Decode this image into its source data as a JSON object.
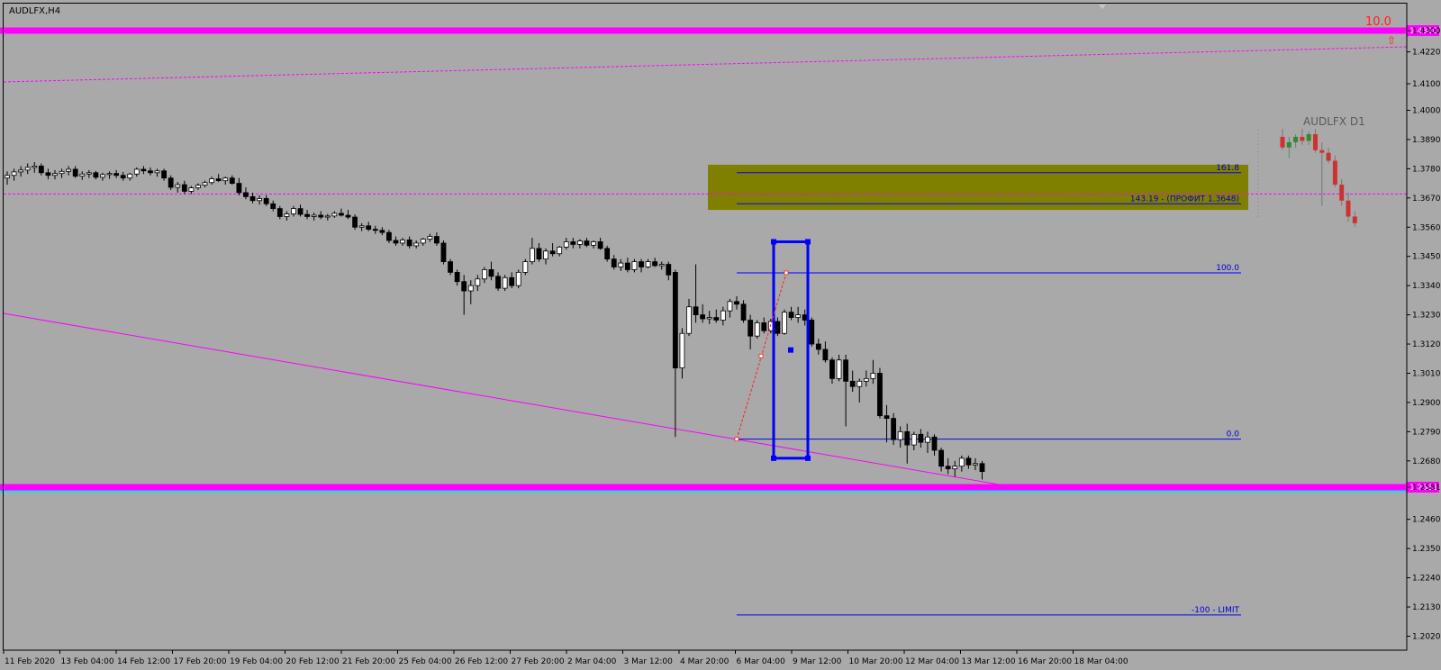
{
  "symbol_title": "AUDLFX,H4",
  "mini_chart_title": "AUDLFX D1",
  "corner_value": "10.0",
  "corner_arrow": "⇧",
  "colors": {
    "background": "#a9a9a9",
    "magenta": "#ff00ff",
    "cyan": "#00e5ee",
    "fib_blue": "#0000ff",
    "zone": "#808000",
    "bull": "#ffffff",
    "bear": "#000000",
    "red": "#ff2020"
  },
  "chart_data": {
    "type": "candlestick",
    "y_range": [
      1.2,
      1.44
    ],
    "price_ticks": [
      "1.4300",
      "1.4220",
      "1.4100",
      "1.4000",
      "1.3890",
      "1.3780",
      "1.3670",
      "1.3560",
      "1.3450",
      "1.3340",
      "1.3230",
      "1.3120",
      "1.3010",
      "1.2900",
      "1.2790",
      "1.2680",
      "1.2581",
      "1.2460",
      "1.2350",
      "1.2240",
      "1.2130",
      "1.2020"
    ],
    "time_labels": [
      "11 Feb 2020",
      "13 Feb 04:00",
      "14 Feb 12:00",
      "17 Feb 20:00",
      "19 Feb 04:00",
      "20 Feb 12:00",
      "21 Feb 20:00",
      "25 Feb 04:00",
      "26 Feb 12:00",
      "27 Feb 20:00",
      "2 Mar 04:00",
      "3 Mar 12:00",
      "4 Mar 20:00",
      "6 Mar 04:00",
      "9 Mar 12:00",
      "10 Mar 20:00",
      "12 Mar 04:00",
      "13 Mar 12:00",
      "16 Mar 20:00",
      "18 Mar 04:00"
    ],
    "horizontal_lines": [
      {
        "name": "upper-level",
        "price": 1.43,
        "label": "1.4300",
        "color": "#ff00ff"
      },
      {
        "name": "lower-level",
        "price": 1.2581,
        "label": "1.2581",
        "color": "#ff00ff"
      }
    ],
    "fib_levels": [
      {
        "level": "161.8",
        "price": 1.3765
      },
      {
        "level": "143.19 - (ПРОФИТ 1.3648)",
        "price": 1.3648
      },
      {
        "level": "100.0",
        "price": 1.3388
      },
      {
        "level": "0.0",
        "price": 1.2762
      },
      {
        "level": "-100 - LIMIT",
        "price": 1.21
      }
    ],
    "target_zone": [
      1.3625,
      1.3795
    ],
    "candles": [
      [
        1.3745,
        1.377,
        1.372,
        1.3755
      ],
      [
        1.3755,
        1.378,
        1.3735,
        1.3768
      ],
      [
        1.3768,
        1.379,
        1.375,
        1.3775
      ],
      [
        1.3775,
        1.38,
        1.376,
        1.3785
      ],
      [
        1.3785,
        1.3805,
        1.3765,
        1.379
      ],
      [
        1.379,
        1.38,
        1.3755,
        1.3765
      ],
      [
        1.3765,
        1.378,
        1.374,
        1.3755
      ],
      [
        1.3755,
        1.3775,
        1.374,
        1.3762
      ],
      [
        1.3762,
        1.378,
        1.3745,
        1.377
      ],
      [
        1.377,
        1.379,
        1.3755,
        1.3778
      ],
      [
        1.3778,
        1.379,
        1.3745,
        1.3752
      ],
      [
        1.3752,
        1.377,
        1.3738,
        1.376
      ],
      [
        1.376,
        1.3775,
        1.3745,
        1.3765
      ],
      [
        1.3765,
        1.3772,
        1.374,
        1.3748
      ],
      [
        1.3748,
        1.3765,
        1.3735,
        1.3758
      ],
      [
        1.3758,
        1.377,
        1.3742,
        1.3762
      ],
      [
        1.3762,
        1.3775,
        1.3745,
        1.3755
      ],
      [
        1.3755,
        1.3768,
        1.3735,
        1.3745
      ],
      [
        1.3745,
        1.3765,
        1.3735,
        1.376
      ],
      [
        1.376,
        1.3785,
        1.375,
        1.3778
      ],
      [
        1.3778,
        1.379,
        1.376,
        1.3772
      ],
      [
        1.3772,
        1.3785,
        1.3755,
        1.3765
      ],
      [
        1.3765,
        1.378,
        1.375,
        1.3772
      ],
      [
        1.3772,
        1.378,
        1.3735,
        1.3745
      ],
      [
        1.3745,
        1.3755,
        1.37,
        1.371
      ],
      [
        1.371,
        1.373,
        1.369,
        1.372
      ],
      [
        1.372,
        1.3735,
        1.3685,
        1.3695
      ],
      [
        1.3695,
        1.3715,
        1.3685,
        1.3708
      ],
      [
        1.3708,
        1.3725,
        1.37,
        1.3718
      ],
      [
        1.3718,
        1.3735,
        1.371,
        1.3728
      ],
      [
        1.3728,
        1.375,
        1.372,
        1.3742
      ],
      [
        1.3742,
        1.376,
        1.373,
        1.3735
      ],
      [
        1.3735,
        1.375,
        1.372,
        1.3745
      ],
      [
        1.3745,
        1.3755,
        1.372,
        1.3725
      ],
      [
        1.3725,
        1.3745,
        1.368,
        1.369
      ],
      [
        1.369,
        1.371,
        1.3665,
        1.3675
      ],
      [
        1.3675,
        1.369,
        1.365,
        1.366
      ],
      [
        1.366,
        1.368,
        1.3645,
        1.3668
      ],
      [
        1.3668,
        1.368,
        1.364,
        1.3648
      ],
      [
        1.3648,
        1.366,
        1.362,
        1.363
      ],
      [
        1.363,
        1.364,
        1.359,
        1.36
      ],
      [
        1.36,
        1.362,
        1.3585,
        1.361
      ],
      [
        1.361,
        1.364,
        1.36,
        1.363
      ],
      [
        1.363,
        1.3645,
        1.36,
        1.3608
      ],
      [
        1.3608,
        1.3625,
        1.359,
        1.36
      ],
      [
        1.36,
        1.3615,
        1.3585,
        1.3605
      ],
      [
        1.3605,
        1.362,
        1.359,
        1.3598
      ],
      [
        1.3598,
        1.361,
        1.3585,
        1.3602
      ],
      [
        1.3602,
        1.362,
        1.3595,
        1.3612
      ],
      [
        1.3612,
        1.363,
        1.36,
        1.3605
      ],
      [
        1.3605,
        1.3625,
        1.359,
        1.3598
      ],
      [
        1.3598,
        1.3608,
        1.355,
        1.356
      ],
      [
        1.356,
        1.3575,
        1.3545,
        1.3565
      ],
      [
        1.3565,
        1.358,
        1.3545,
        1.3552
      ],
      [
        1.3552,
        1.3565,
        1.3535,
        1.3548
      ],
      [
        1.3548,
        1.356,
        1.353,
        1.354
      ],
      [
        1.354,
        1.355,
        1.35,
        1.351
      ],
      [
        1.351,
        1.3525,
        1.349,
        1.35
      ],
      [
        1.35,
        1.352,
        1.349,
        1.3512
      ],
      [
        1.3512,
        1.3525,
        1.348,
        1.349
      ],
      [
        1.349,
        1.351,
        1.348,
        1.35
      ],
      [
        1.35,
        1.352,
        1.349,
        1.3515
      ],
      [
        1.3515,
        1.3535,
        1.3505,
        1.3525
      ],
      [
        1.3525,
        1.354,
        1.349,
        1.35
      ],
      [
        1.35,
        1.351,
        1.342,
        1.343
      ],
      [
        1.343,
        1.344,
        1.338,
        1.339
      ],
      [
        1.339,
        1.34,
        1.334,
        1.3355
      ],
      [
        1.3355,
        1.338,
        1.323,
        1.332
      ],
      [
        1.332,
        1.336,
        1.327,
        1.334
      ],
      [
        1.334,
        1.338,
        1.332,
        1.3365
      ],
      [
        1.3365,
        1.341,
        1.335,
        1.34
      ],
      [
        1.34,
        1.343,
        1.336,
        1.3375
      ],
      [
        1.3375,
        1.339,
        1.332,
        1.333
      ],
      [
        1.333,
        1.338,
        1.332,
        1.337
      ],
      [
        1.337,
        1.339,
        1.333,
        1.334
      ],
      [
        1.334,
        1.34,
        1.333,
        1.339
      ],
      [
        1.339,
        1.344,
        1.338,
        1.343
      ],
      [
        1.343,
        1.352,
        1.342,
        1.348
      ],
      [
        1.348,
        1.35,
        1.343,
        1.344
      ],
      [
        1.344,
        1.348,
        1.342,
        1.347
      ],
      [
        1.347,
        1.35,
        1.345,
        1.346
      ],
      [
        1.346,
        1.349,
        1.345,
        1.3485
      ],
      [
        1.3485,
        1.352,
        1.3475,
        1.3505
      ],
      [
        1.3505,
        1.352,
        1.348,
        1.3495
      ],
      [
        1.3495,
        1.3515,
        1.348,
        1.3508
      ],
      [
        1.3508,
        1.352,
        1.3485,
        1.3492
      ],
      [
        1.3492,
        1.351,
        1.348,
        1.3505
      ],
      [
        1.3505,
        1.352,
        1.3475,
        1.348
      ],
      [
        1.348,
        1.349,
        1.343,
        1.344
      ],
      [
        1.344,
        1.3455,
        1.34,
        1.341
      ],
      [
        1.341,
        1.344,
        1.3395,
        1.3425
      ],
      [
        1.3425,
        1.3445,
        1.339,
        1.34
      ],
      [
        1.34,
        1.344,
        1.339,
        1.343
      ],
      [
        1.343,
        1.344,
        1.339,
        1.341
      ],
      [
        1.341,
        1.344,
        1.3405,
        1.343
      ],
      [
        1.343,
        1.3445,
        1.341,
        1.3415
      ],
      [
        1.3415,
        1.343,
        1.34,
        1.342
      ],
      [
        1.342,
        1.343,
        1.336,
        1.338
      ],
      [
        1.339,
        1.34,
        1.277,
        1.303
      ],
      [
        1.303,
        1.318,
        1.299,
        1.316
      ],
      [
        1.316,
        1.329,
        1.315,
        1.326
      ],
      [
        1.326,
        1.342,
        1.32,
        1.323
      ],
      [
        1.323,
        1.327,
        1.32,
        1.3215
      ],
      [
        1.3215,
        1.3245,
        1.3195,
        1.322
      ],
      [
        1.322,
        1.325,
        1.32,
        1.321
      ],
      [
        1.321,
        1.326,
        1.319,
        1.3245
      ],
      [
        1.3245,
        1.329,
        1.322,
        1.328
      ],
      [
        1.328,
        1.33,
        1.325,
        1.327
      ],
      [
        1.327,
        1.3285,
        1.32,
        1.321
      ],
      [
        1.321,
        1.323,
        1.31,
        1.315
      ],
      [
        1.315,
        1.321,
        1.314,
        1.32
      ],
      [
        1.32,
        1.322,
        1.316,
        1.317
      ],
      [
        1.317,
        1.3215,
        1.316,
        1.3205
      ],
      [
        1.3205,
        1.322,
        1.315,
        1.316
      ],
      [
        1.316,
        1.325,
        1.3155,
        1.324
      ],
      [
        1.324,
        1.326,
        1.321,
        1.322
      ],
      [
        1.322,
        1.326,
        1.32,
        1.323
      ],
      [
        1.323,
        1.325,
        1.319,
        1.321
      ],
      [
        1.321,
        1.322,
        1.311,
        1.312
      ],
      [
        1.312,
        1.314,
        1.308,
        1.31
      ],
      [
        1.31,
        1.313,
        1.305,
        1.306
      ],
      [
        1.306,
        1.307,
        1.297,
        1.299
      ],
      [
        1.299,
        1.308,
        1.298,
        1.306
      ],
      [
        1.306,
        1.308,
        1.281,
        1.298
      ],
      [
        1.298,
        1.302,
        1.294,
        1.296
      ],
      [
        1.296,
        1.299,
        1.29,
        1.298
      ],
      [
        1.298,
        1.302,
        1.296,
        1.299
      ],
      [
        1.299,
        1.306,
        1.297,
        1.301
      ],
      [
        1.301,
        1.303,
        1.284,
        1.285
      ],
      [
        1.285,
        1.289,
        1.275,
        1.284
      ],
      [
        1.284,
        1.286,
        1.274,
        1.276
      ],
      [
        1.276,
        1.281,
        1.273,
        1.279
      ],
      [
        1.279,
        1.282,
        1.267,
        1.274
      ],
      [
        1.274,
        1.279,
        1.272,
        1.278
      ],
      [
        1.278,
        1.28,
        1.273,
        1.275
      ],
      [
        1.275,
        1.279,
        1.271,
        1.277
      ],
      [
        1.277,
        1.278,
        1.27,
        1.272
      ],
      [
        1.272,
        1.273,
        1.264,
        1.266
      ],
      [
        1.266,
        1.269,
        1.263,
        1.265
      ],
      [
        1.265,
        1.268,
        1.262,
        1.266
      ],
      [
        1.266,
        1.27,
        1.264,
        1.269
      ],
      [
        1.269,
        1.27,
        1.265,
        1.2665
      ],
      [
        1.2665,
        1.269,
        1.2645,
        1.267
      ],
      [
        1.267,
        1.268,
        1.261,
        1.264
      ]
    ],
    "daily_candles": [
      [
        1.39,
        1.393,
        1.385,
        1.386
      ],
      [
        1.386,
        1.39,
        1.382,
        1.388
      ],
      [
        1.388,
        1.391,
        1.386,
        1.39
      ],
      [
        1.39,
        1.393,
        1.387,
        1.3885
      ],
      [
        1.3885,
        1.392,
        1.387,
        1.391
      ],
      [
        1.391,
        1.393,
        1.384,
        1.385
      ],
      [
        1.385,
        1.388,
        1.364,
        1.384
      ],
      [
        1.384,
        1.386,
        1.38,
        1.381
      ],
      [
        1.381,
        1.383,
        1.371,
        1.372
      ],
      [
        1.372,
        1.374,
        1.364,
        1.366
      ],
      [
        1.366,
        1.369,
        1.358,
        1.36
      ],
      [
        1.36,
        1.362,
        1.356,
        1.3575
      ]
    ]
  }
}
